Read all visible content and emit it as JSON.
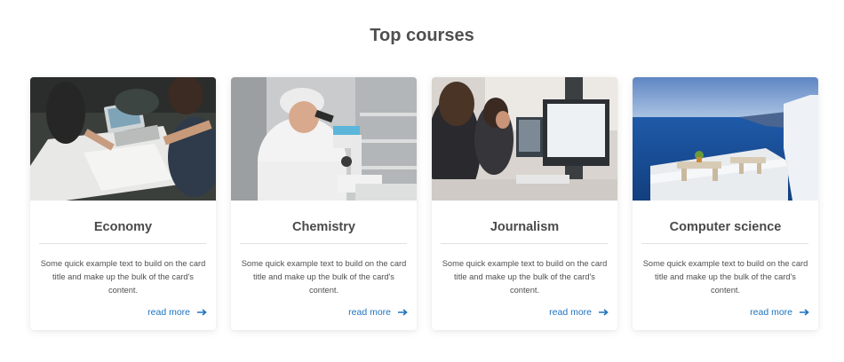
{
  "section": {
    "title": "Top courses"
  },
  "colors": {
    "link": "#1e73be",
    "text": "#4f4f4f",
    "divider": "#e1e1e1"
  },
  "cards": [
    {
      "title": "Economy",
      "text": "Some quick example text to build on the card title and make up the bulk of the card's content.",
      "link": "read more",
      "link_icon": "arrow-right-icon",
      "image": "people-working-with-laptop-and-papers"
    },
    {
      "title": "Chemistry",
      "text": "Some quick example text to build on the card title and make up the bulk of the card's content.",
      "link": "read more",
      "link_icon": "arrow-right-icon",
      "image": "scientist-with-microscope"
    },
    {
      "title": "Journalism",
      "text": "Some quick example text to build on the card title and make up the bulk of the card's content.",
      "link": "read more",
      "link_icon": "arrow-right-icon",
      "image": "women-at-computer-monitors"
    },
    {
      "title": "Computer science",
      "text": "Some quick example text to build on the card title and make up the bulk of the card's content.",
      "link": "read more",
      "link_icon": "arrow-right-icon",
      "image": "sea-view-terrace"
    }
  ]
}
